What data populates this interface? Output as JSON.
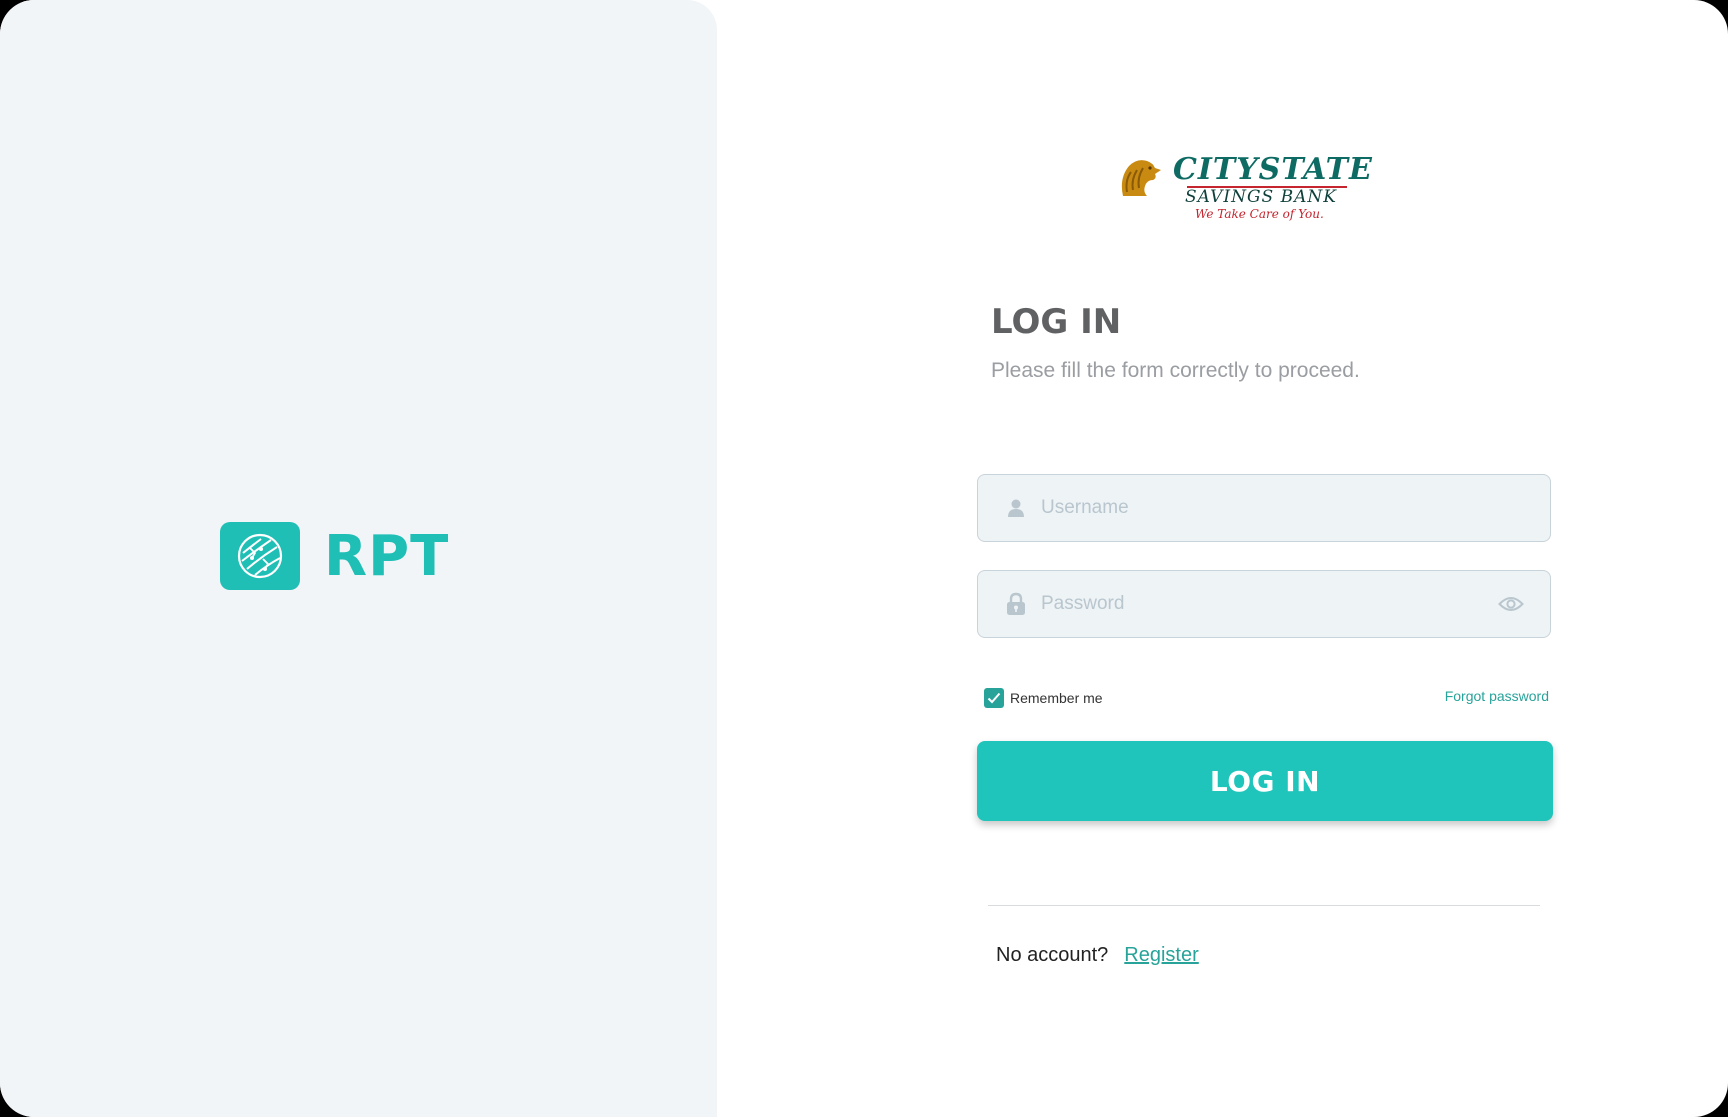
{
  "brand": {
    "name": "RPT",
    "color": "#1fbfb6"
  },
  "bank": {
    "name": "CITYSTATE",
    "subtitle": "SAVINGS BANK",
    "tagline": "We Take Care of You."
  },
  "form": {
    "title": "LOG IN",
    "subtitle": "Please fill the form correctly to proceed.",
    "username": {
      "placeholder": "Username",
      "value": "",
      "icon": "user-icon"
    },
    "password": {
      "placeholder": "Password",
      "value": "",
      "icon": "lock-icon",
      "toggle_icon": "eye-icon"
    },
    "remember": {
      "label": "Remember me",
      "checked": true
    },
    "forgot_label": "Forgot password",
    "submit_label": "LOG IN"
  },
  "footer": {
    "prompt": "No account?",
    "register_label": "Register"
  },
  "colors": {
    "accent": "#1fc4bb",
    "link": "#27a39a",
    "panel": "#f1f5f8"
  }
}
